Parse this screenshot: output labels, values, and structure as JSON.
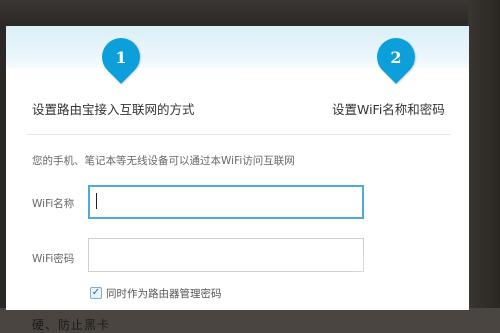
{
  "steps": [
    {
      "number": "1",
      "label": "设置路由宝接入互联网的方式"
    },
    {
      "number": "2",
      "label": "设置WiFi名称和密码"
    }
  ],
  "description": "您的手机、笔记本等无线设备可以通过本WiFi访问互联网",
  "form": {
    "wifi_name_label": "WiFi名称",
    "wifi_name_value": "",
    "wifi_password_label": "WiFi密码",
    "wifi_password_value": "",
    "use_as_admin_password_label": "同时作为路由器管理密码",
    "use_as_admin_password_checked": true,
    "checkbox_mark": "✓"
  },
  "background": {
    "partial_text": "硬、防止黑卡"
  },
  "colors": {
    "accent": "#0d9fd9",
    "focus_border": "#4eaad8",
    "header_band": "#dbeff8"
  }
}
